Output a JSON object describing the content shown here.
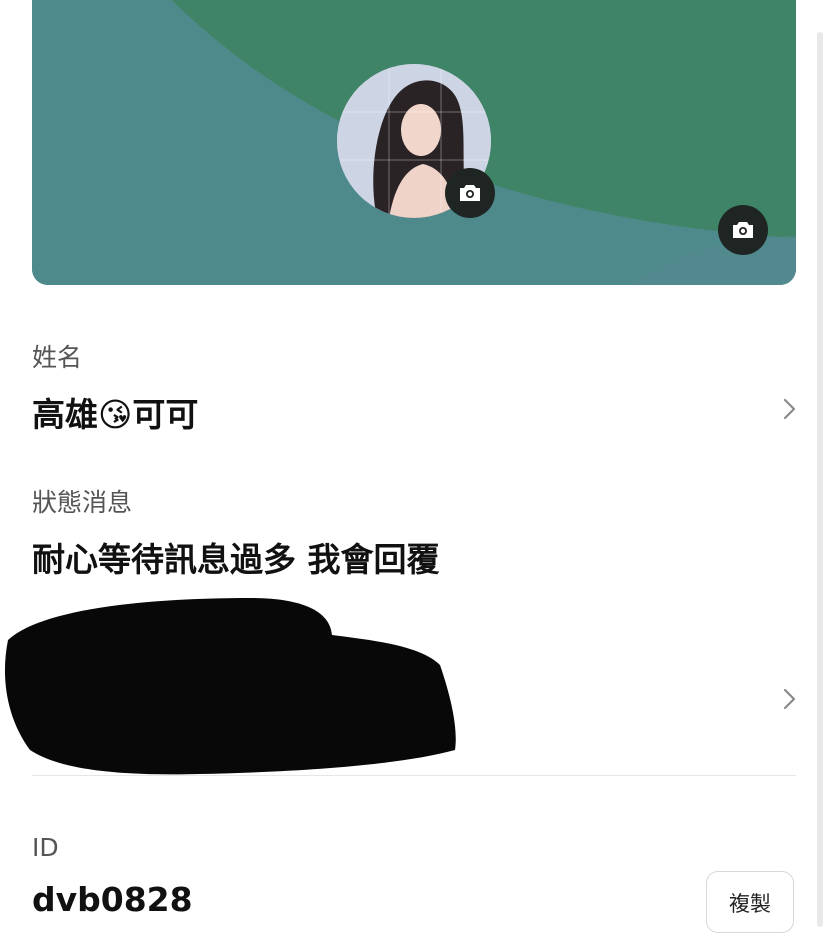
{
  "profile": {
    "name_label": "姓名",
    "name_value": "高雄😘可可",
    "status_label": "狀態消息",
    "status_value": "耐心等待訊息過多 我會回覆",
    "id_label": "ID",
    "id_value": "dvb0828",
    "copy_label": "複製"
  },
  "colors": {
    "cover_teal": "#4e8a8c",
    "cover_green": "#3f8466",
    "camera_button": "#1f2522"
  },
  "icons": {
    "avatar_camera": "camera-icon",
    "cover_camera": "camera-icon",
    "chevron": "chevron-right-icon"
  }
}
